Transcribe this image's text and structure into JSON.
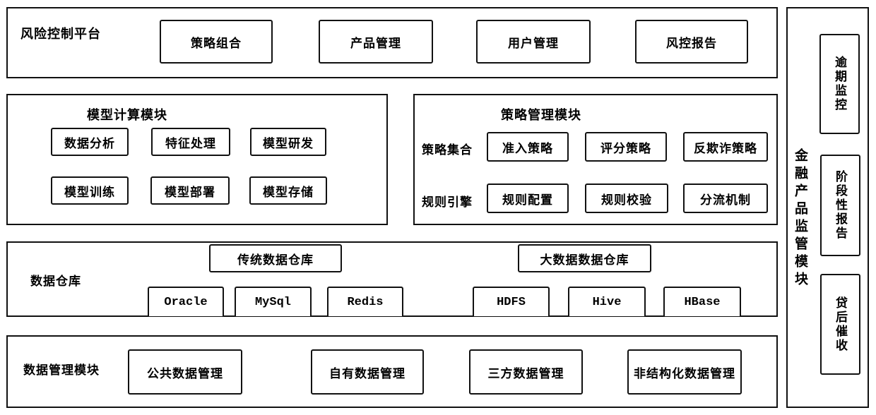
{
  "risk_platform": {
    "title": "风险控制平台",
    "items": [
      "策略组合",
      "产品管理",
      "用户管理",
      "风控报告"
    ]
  },
  "model_module": {
    "title": "模型计算模块",
    "rows": [
      [
        "数据分析",
        "特征处理",
        "模型研发"
      ],
      [
        "模型训练",
        "模型部署",
        "模型存储"
      ]
    ]
  },
  "strategy_module": {
    "title": "策略管理模块",
    "rows": [
      {
        "label": "策略集合",
        "items": [
          "准入策略",
          "评分策略",
          "反欺诈策略"
        ]
      },
      {
        "label": "规则引擎",
        "items": [
          "规则配置",
          "规则校验",
          "分流机制"
        ]
      }
    ]
  },
  "data_warehouse": {
    "title": "数据仓库",
    "traditional": {
      "title": "传统数据仓库",
      "items": [
        "Oracle",
        "MySql",
        "Redis"
      ]
    },
    "bigdata": {
      "title": "大数据数据仓库",
      "items": [
        "HDFS",
        "Hive",
        "HBase"
      ]
    }
  },
  "data_management": {
    "title": "数据管理模块",
    "items": [
      "公共数据管理",
      "自有数据管理",
      "三方数据管理",
      "非结构化数据管理"
    ]
  },
  "supervision_module": {
    "title": "金融产品监管模块",
    "items": [
      "逾期监控",
      "阶段性报告",
      "贷后催收"
    ]
  }
}
